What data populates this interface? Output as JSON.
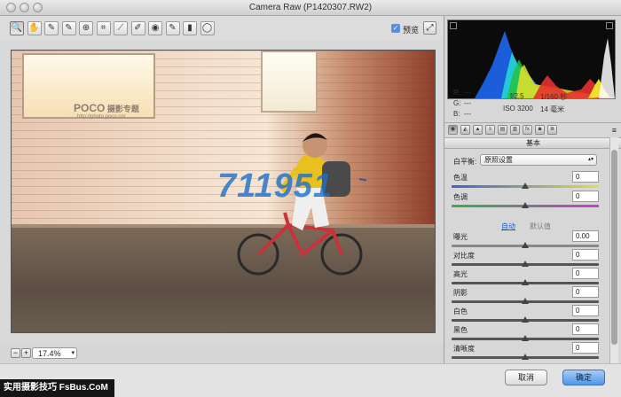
{
  "window": {
    "title": "Camera Raw (P1420307.RW2)"
  },
  "toolbar": {
    "tools": [
      {
        "name": "zoom-tool",
        "glyph": "🔍"
      },
      {
        "name": "hand-tool",
        "glyph": "✋"
      },
      {
        "name": "white-balance-tool",
        "glyph": "✎"
      },
      {
        "name": "color-sampler-tool",
        "glyph": "✎"
      },
      {
        "name": "targeted-adjustment-tool",
        "glyph": "⊕"
      },
      {
        "name": "crop-tool",
        "glyph": "⌗"
      },
      {
        "name": "straighten-tool",
        "glyph": "⟋"
      },
      {
        "name": "spot-removal-tool",
        "glyph": "✐"
      },
      {
        "name": "red-eye-tool",
        "glyph": "◉"
      },
      {
        "name": "adjustment-brush-tool",
        "glyph": "✎"
      },
      {
        "name": "graduated-filter-tool",
        "glyph": "▮"
      },
      {
        "name": "radial-filter-tool",
        "glyph": "◯"
      }
    ],
    "preview_label": "预览",
    "preview_checked": "✓",
    "fullscreen_glyph": "⤢"
  },
  "watermark": {
    "poco": "POCO",
    "poco_sub": " 摄影专题",
    "url": "http://photo.poco.cn/",
    "overlay_number": "711951"
  },
  "zoom": {
    "minus": "−",
    "plus": "+",
    "value": "17.4%",
    "arrow": "▾"
  },
  "histogram": {
    "readout": {
      "r": "R:",
      "g": "G:",
      "b": "B:",
      "r_val": "---",
      "g_val": "---",
      "b_val": "---",
      "aperture": "f/2.5",
      "shutter": "1/160 秒",
      "iso": "ISO 3200",
      "focal": "14 毫米"
    }
  },
  "tabs": {
    "items": [
      "◉",
      "◭",
      "▲",
      "≡",
      "▤",
      "▥",
      "fx",
      "◙",
      "≣"
    ],
    "menu": "≡"
  },
  "basic": {
    "section_title": "基本",
    "wb_label": "白平衡:",
    "wb_value": "原照设置",
    "wb_arrow": "▴▾",
    "auto": "自动",
    "default": "默认值",
    "sliders_top": [
      {
        "label": "色温",
        "value": "0",
        "level": 0.5
      },
      {
        "label": "色调",
        "value": "0",
        "level": 0.5
      }
    ],
    "sliders": [
      {
        "label": "曝光",
        "value": "0.00",
        "level": 0.5
      },
      {
        "label": "对比度",
        "value": "0",
        "level": 0.5
      },
      {
        "label": "高光",
        "value": "0",
        "level": 0.5
      },
      {
        "label": "阴影",
        "value": "0",
        "level": 0.5
      },
      {
        "label": "白色",
        "value": "0",
        "level": 0.5
      },
      {
        "label": "黑色",
        "value": "0",
        "level": 0.5
      },
      {
        "label": "清晰度",
        "value": "0",
        "level": 0.5
      }
    ]
  },
  "buttons": {
    "cancel": "取消",
    "ok": "确定"
  },
  "footer_badge": "实用摄影技巧 FsBus.CoM"
}
